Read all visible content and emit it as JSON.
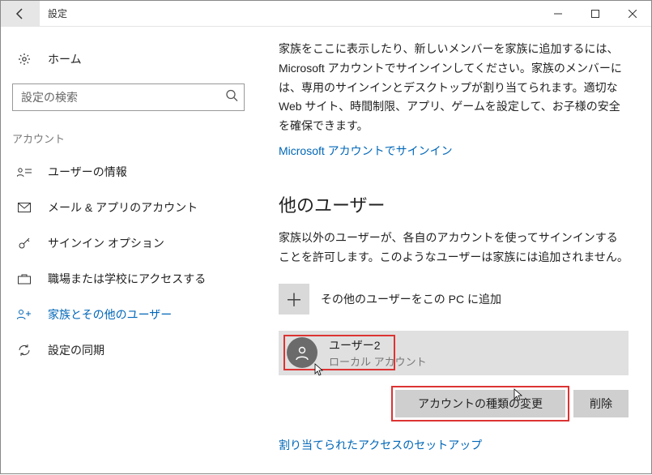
{
  "titlebar": {
    "title": "設定"
  },
  "sidebar": {
    "home": "ホーム",
    "search_placeholder": "設定の検索",
    "section": "アカウント",
    "items": [
      {
        "label": "ユーザーの情報"
      },
      {
        "label": "メール & アプリのアカウント"
      },
      {
        "label": "サインイン オプション"
      },
      {
        "label": "職場または学校にアクセスする"
      },
      {
        "label": "家族とその他のユーザー"
      },
      {
        "label": "設定の同期"
      }
    ]
  },
  "main": {
    "family_desc": "家族をここに表示したり、新しいメンバーを家族に追加するには、Microsoft アカウントでサインインしてください。家族のメンバーには、専用のサインインとデスクトップが割り当てられます。適切な Web サイト、時間制限、アプリ、ゲームを設定して、お子様の安全を確保できます。",
    "signin_link": "Microsoft アカウントでサインイン",
    "other_heading": "他のユーザー",
    "other_desc": "家族以外のユーザーが、各自のアカウントを使ってサインインすることを許可します。このようなユーザーは家族には追加されません。",
    "add_label": "その他のユーザーをこの PC に追加",
    "user": {
      "name": "ユーザー2",
      "type": "ローカル アカウント"
    },
    "btn_change": "アカウントの種類の変更",
    "btn_delete": "削除",
    "assigned_link": "割り当てられたアクセスのセットアップ"
  }
}
